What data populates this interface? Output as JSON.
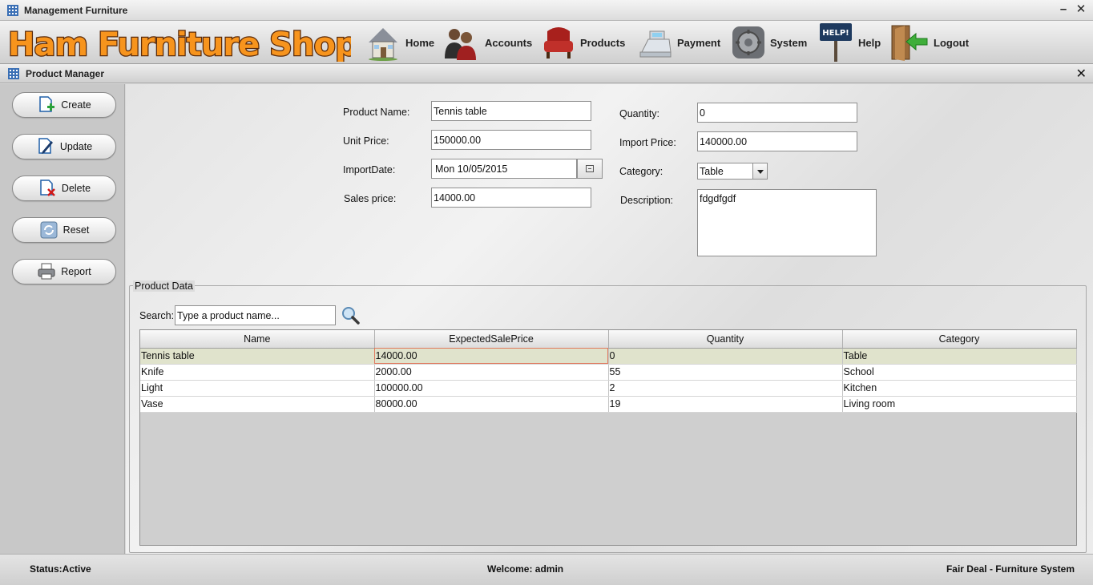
{
  "window": {
    "title": "Management Furniture",
    "minimize": "–",
    "close": "✕"
  },
  "logo": {
    "text": "Ham Furniture Shop"
  },
  "nav": [
    {
      "label": "Home",
      "icon": "house-icon"
    },
    {
      "label": "Accounts",
      "icon": "people-icon"
    },
    {
      "label": "Products",
      "icon": "armchair-icon"
    },
    {
      "label": "Payment",
      "icon": "cash-register-icon"
    },
    {
      "label": "System",
      "icon": "gear-icon"
    },
    {
      "label": "Help",
      "icon": "help-sign-icon"
    },
    {
      "label": "Logout",
      "icon": "logout-door-icon"
    }
  ],
  "panel": {
    "title": "Product Manager",
    "close": "✕"
  },
  "sidebar": {
    "buttons": [
      {
        "label": "Create",
        "icon": "create-doc-icon"
      },
      {
        "label": "Update",
        "icon": "edit-doc-icon"
      },
      {
        "label": "Delete",
        "icon": "delete-doc-icon"
      },
      {
        "label": "Reset",
        "icon": "refresh-icon"
      },
      {
        "label": "Report",
        "icon": "printer-icon"
      }
    ]
  },
  "form": {
    "product_name": {
      "label": "Product Name:",
      "value": "Tennis table"
    },
    "unit_price": {
      "label": "Unit Price:",
      "value": "150000.00"
    },
    "import_date": {
      "label": "ImportDate:",
      "value": "Mon 10/05/2015"
    },
    "sales_price": {
      "label": "Sales price:",
      "value": "14000.00"
    },
    "quantity": {
      "label": "Quantity:",
      "value": "0"
    },
    "import_price": {
      "label": "Import Price:",
      "value": "140000.00"
    },
    "category": {
      "label": "Category:",
      "value": "Table"
    },
    "description": {
      "label": "Description:",
      "value": "fdgdfgdf"
    }
  },
  "product_data": {
    "title": "Product Data",
    "search_label": "Search:",
    "search_placeholder": "Type a product name...",
    "columns": [
      "Name",
      "ExpectedSalePrice",
      "Quantity",
      "Category"
    ],
    "rows": [
      [
        "Tennis table",
        "14000.00",
        "0",
        "Table"
      ],
      [
        "Knife",
        "2000.00",
        "55",
        "School"
      ],
      [
        "Light",
        "100000.00",
        "2",
        "Kitchen"
      ],
      [
        "Vase",
        "80000.00",
        "19",
        "Living room"
      ]
    ],
    "selected_row": 0
  },
  "status": {
    "left": "Status:Active",
    "center": "Welcome: admin",
    "right": "Fair Deal - Furniture System"
  },
  "colors": {
    "logo_orange": "#f7941d",
    "logo_outline": "#5a2a0a",
    "selected_row": "#e0e3cc",
    "focus_cell": "#e07a5f"
  }
}
